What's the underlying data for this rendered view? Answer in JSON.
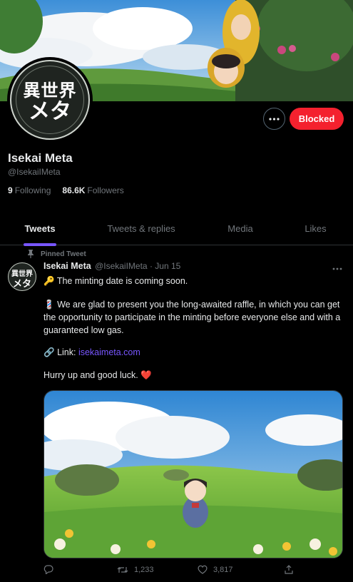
{
  "profile": {
    "avatar_line1": "異世界",
    "avatar_line2": "メタ",
    "name": "Isekai Meta",
    "handle": "@IsekaiIMeta",
    "following_count": "9",
    "following_label": "Following",
    "followers_count": "86.6K",
    "followers_label": "Followers",
    "blocked_label": "Blocked",
    "more_icon": "ellipsis-icon"
  },
  "tabs": [
    {
      "label": "Tweets",
      "active": true
    },
    {
      "label": "Tweets & replies",
      "active": false
    },
    {
      "label": "Media",
      "active": false
    },
    {
      "label": "Likes",
      "active": false
    }
  ],
  "tweet": {
    "pinned_label": "Pinned Tweet",
    "author": "Isekai Meta",
    "handle": "@IsekaiIMeta",
    "separator": "·",
    "date": "Jun 15",
    "line1_emoji": "🔑",
    "line1": "The minting date is coming soon.",
    "para2_emoji": "💈",
    "para2": "We are glad to present you the long-awaited raffle, in which you can get the opportunity to participate in the minting before everyone else and with a guaranteed low gas.",
    "link_emoji": "🔗",
    "link_label": "Link:",
    "link_url": "isekaimeta.com",
    "closing": "Hurry up and good luck.",
    "closing_emoji": "❤️",
    "retweets": "1,233",
    "likes": "3,817"
  },
  "colors": {
    "accent": "#7856ff",
    "blocked": "#f4212e",
    "muted": "#71767b"
  }
}
